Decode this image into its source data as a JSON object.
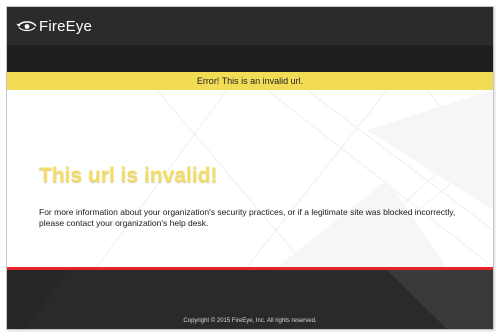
{
  "header": {
    "brand_name": "FireEye",
    "logo_icon": "fireeye-eye-logo-icon"
  },
  "banner": {
    "text": "Error! This is an invalid url."
  },
  "main": {
    "headline": "This url is invalid!",
    "message": "For more information about your organization's security practices, or if a legitimate site was blocked incorrectly, please contact your organization's help desk."
  },
  "footer": {
    "copyright": "Copyright © 2015 FireEye, Inc. All rights reserved."
  },
  "colors": {
    "header_bg": "#2b2b2b",
    "banner_bg": "#f3dc55",
    "headline": "#f4dd66",
    "footer_accent": "#e4232b",
    "footer_bg": "#2a2a2a"
  }
}
